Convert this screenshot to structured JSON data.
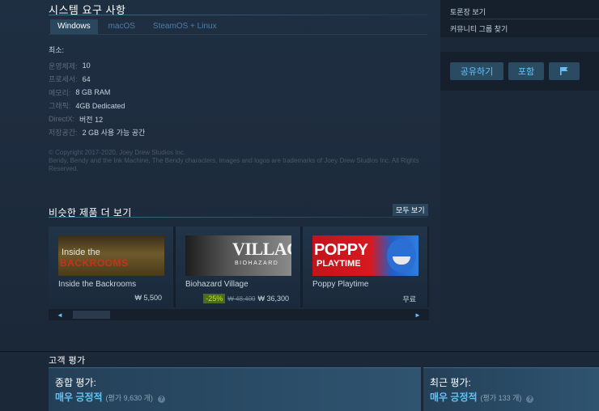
{
  "sysreq": {
    "title": "시스템 요구 사항",
    "tabs": [
      "Windows",
      "macOS",
      "SteamOS + Linux"
    ],
    "min_label": "최소:",
    "rows": [
      {
        "label": "운영체제:",
        "value": "10"
      },
      {
        "label": "프로세서:",
        "value": "64"
      },
      {
        "label": "메모리:",
        "value": "8 GB RAM"
      },
      {
        "label": "그래픽:",
        "value": "4GB Dedicated"
      },
      {
        "label": "DirectX:",
        "value": "버전 12"
      },
      {
        "label": "저장공간:",
        "value": "2 GB 사용 가능 공간"
      }
    ]
  },
  "legal": {
    "line1": "© Copyright 2017-2020, Joey Drew Studios Inc.",
    "line2": "Bendy, Bendy and the Ink Machine, The Bendy characters, images and logos are trademarks of Joey Drew Studios Inc. All Rights Reserved."
  },
  "more": {
    "title": "비슷한 제품 더 보기",
    "see_all": "모두 보기",
    "games": [
      {
        "name": "Inside the Backrooms",
        "price": "₩ 5,500",
        "cap_line1": "Inside the",
        "cap_line2": "BACKROOMS"
      },
      {
        "name": "Biohazard Village",
        "discount": "-25%",
        "original": "₩ 48,400",
        "price": "₩ 36,300",
        "cap_line1": "VILLAGE",
        "cap_line2": "BIOHAZARD"
      },
      {
        "name": "Poppy Playtime",
        "price": "무료",
        "cap_line1": "POPPY",
        "cap_line2": "PLAYTIME"
      }
    ],
    "scroll_left": "◄",
    "scroll_right": "►"
  },
  "side": {
    "links": [
      "토론장 보기",
      "커뮤니티 그룹 찾기"
    ],
    "share_label": "공유하기",
    "embed_label": "포함"
  },
  "reviews": {
    "title": "고객 평가",
    "overall_label": "종합 평가:",
    "overall_score": "매우 긍정적",
    "overall_count": "(평가 9,630 개)",
    "recent_label": "최근 평가:",
    "recent_score": "매우 긍정적",
    "recent_count": "(평가 133 개)",
    "help": "?"
  },
  "icons": {
    "flag": "flag-icon"
  },
  "colors": {
    "background": "#1b2838",
    "accent": "#66c0f4",
    "discount_bg": "#4c6b22",
    "discount_text": "#beee11"
  }
}
